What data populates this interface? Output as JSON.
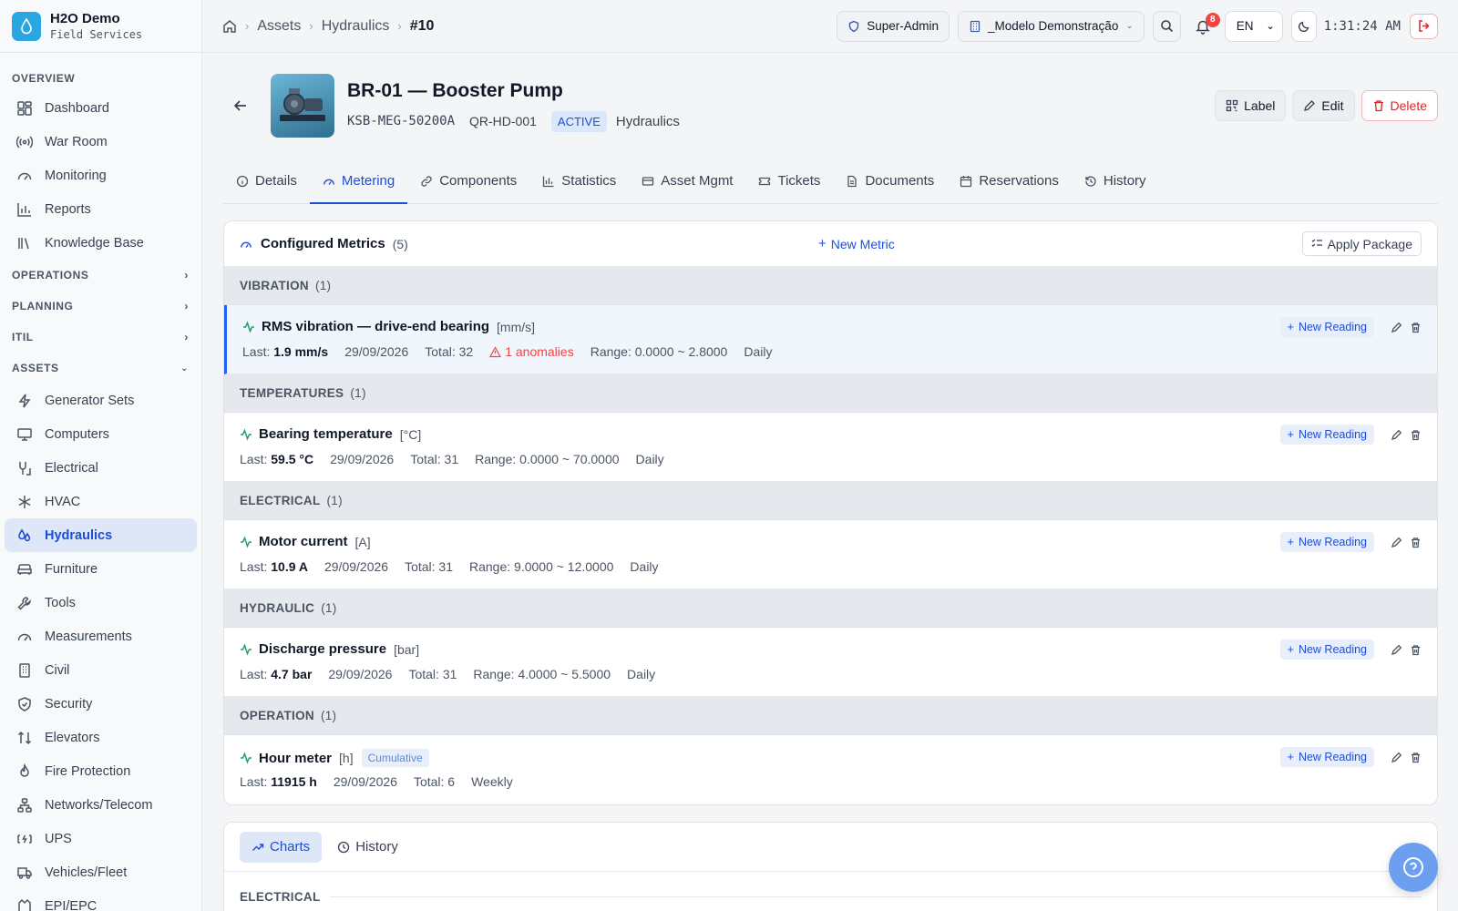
{
  "brand": {
    "title": "H2O Demo",
    "subtitle": "Field Services",
    "accent": "#2aa6e0"
  },
  "sidebar": {
    "overview_label": "OVERVIEW",
    "overview_items": [
      {
        "label": "Dashboard",
        "icon": "dashboard-icon"
      },
      {
        "label": "War Room",
        "icon": "broadcast-icon"
      },
      {
        "label": "Monitoring",
        "icon": "gauge-icon"
      },
      {
        "label": "Reports",
        "icon": "bar-chart-icon"
      },
      {
        "label": "Knowledge Base",
        "icon": "library-icon"
      }
    ],
    "operations_label": "OPERATIONS",
    "planning_label": "PLANNING",
    "itil_label": "ITIL",
    "assets_label": "ASSETS",
    "asset_items": [
      {
        "label": "Generator Sets",
        "icon": "bolt-icon"
      },
      {
        "label": "Computers",
        "icon": "monitor-icon"
      },
      {
        "label": "Electrical",
        "icon": "plug-icon"
      },
      {
        "label": "HVAC",
        "icon": "snowflake-icon"
      },
      {
        "label": "Hydraulics",
        "icon": "droplets-icon"
      },
      {
        "label": "Furniture",
        "icon": "sofa-icon"
      },
      {
        "label": "Tools",
        "icon": "wrench-icon"
      },
      {
        "label": "Measurements",
        "icon": "gauge-icon"
      },
      {
        "label": "Civil",
        "icon": "building-icon"
      },
      {
        "label": "Security",
        "icon": "shield-icon"
      },
      {
        "label": "Elevators",
        "icon": "arrows-updown-icon"
      },
      {
        "label": "Fire Protection",
        "icon": "flame-icon"
      },
      {
        "label": "Networks/Telecom",
        "icon": "network-icon"
      },
      {
        "label": "UPS",
        "icon": "battery-icon"
      },
      {
        "label": "Vehicles/Fleet",
        "icon": "truck-icon"
      },
      {
        "label": "EPI/EPC",
        "icon": "vest-icon"
      }
    ]
  },
  "topbar": {
    "breadcrumb": [
      "Assets",
      "Hydraulics",
      "#10"
    ],
    "role": "Super-Admin",
    "tenant": "_Modelo Demonstração",
    "notifications": "8",
    "language": "EN",
    "time": "1:31:24 AM"
  },
  "asset": {
    "title": "BR-01 — Booster Pump",
    "serial": "KSB-MEG-50200A",
    "qr": "QR-HD-001",
    "status": "ACTIVE",
    "category": "Hydraulics",
    "label_btn": "Label",
    "edit_btn": "Edit",
    "delete_btn": "Delete"
  },
  "tabs": [
    {
      "label": "Details",
      "icon": "info-icon"
    },
    {
      "label": "Metering",
      "icon": "gauge-icon"
    },
    {
      "label": "Components",
      "icon": "link-icon"
    },
    {
      "label": "Statistics",
      "icon": "bar-chart-icon"
    },
    {
      "label": "Asset Mgmt",
      "icon": "card-icon"
    },
    {
      "label": "Tickets",
      "icon": "ticket-icon"
    },
    {
      "label": "Documents",
      "icon": "document-icon"
    },
    {
      "label": "Reservations",
      "icon": "calendar-icon"
    },
    {
      "label": "History",
      "icon": "history-icon"
    }
  ],
  "metrics_card": {
    "title": "Configured Metrics",
    "count": "(5)",
    "new_metric": "New Metric",
    "apply_package": "Apply Package",
    "new_reading": "New Reading",
    "groups": [
      {
        "name": "VIBRATION",
        "count": "(1)",
        "metrics": [
          {
            "name": "RMS vibration — drive-end bearing",
            "unit": "[mm/s]",
            "last_label": "Last:",
            "last": "1.9 mm/s",
            "date": "29/09/2026",
            "total": "Total: 32",
            "anomalies": "1 anomalies",
            "range": "Range: 0.0000 ~ 2.8000",
            "freq": "Daily",
            "selected": true
          }
        ]
      },
      {
        "name": "TEMPERATURES",
        "count": "(1)",
        "metrics": [
          {
            "name": "Bearing temperature",
            "unit": "[°C]",
            "last_label": "Last:",
            "last": "59.5 °C",
            "date": "29/09/2026",
            "total": "Total: 31",
            "range": "Range: 0.0000 ~ 70.0000",
            "freq": "Daily"
          }
        ]
      },
      {
        "name": "ELECTRICAL",
        "count": "(1)",
        "metrics": [
          {
            "name": "Motor current",
            "unit": "[A]",
            "last_label": "Last:",
            "last": "10.9 A",
            "date": "29/09/2026",
            "total": "Total: 31",
            "range": "Range: 9.0000 ~ 12.0000",
            "freq": "Daily"
          }
        ]
      },
      {
        "name": "HYDRAULIC",
        "count": "(1)",
        "metrics": [
          {
            "name": "Discharge pressure",
            "unit": "[bar]",
            "last_label": "Last:",
            "last": "4.7 bar",
            "date": "29/09/2026",
            "total": "Total: 31",
            "range": "Range: 4.0000 ~ 5.5000",
            "freq": "Daily"
          }
        ]
      },
      {
        "name": "OPERATION",
        "count": "(1)",
        "metrics": [
          {
            "name": "Hour meter",
            "unit": "[h]",
            "tag": "Cumulative",
            "last_label": "Last:",
            "last": "11915 h",
            "date": "29/09/2026",
            "total": "Total: 6",
            "freq": "Weekly"
          }
        ]
      }
    ]
  },
  "charts_card": {
    "tabs": [
      {
        "label": "Charts",
        "icon": "trend-icon"
      },
      {
        "label": "History",
        "icon": "clock-icon"
      }
    ],
    "section": "ELECTRICAL"
  }
}
